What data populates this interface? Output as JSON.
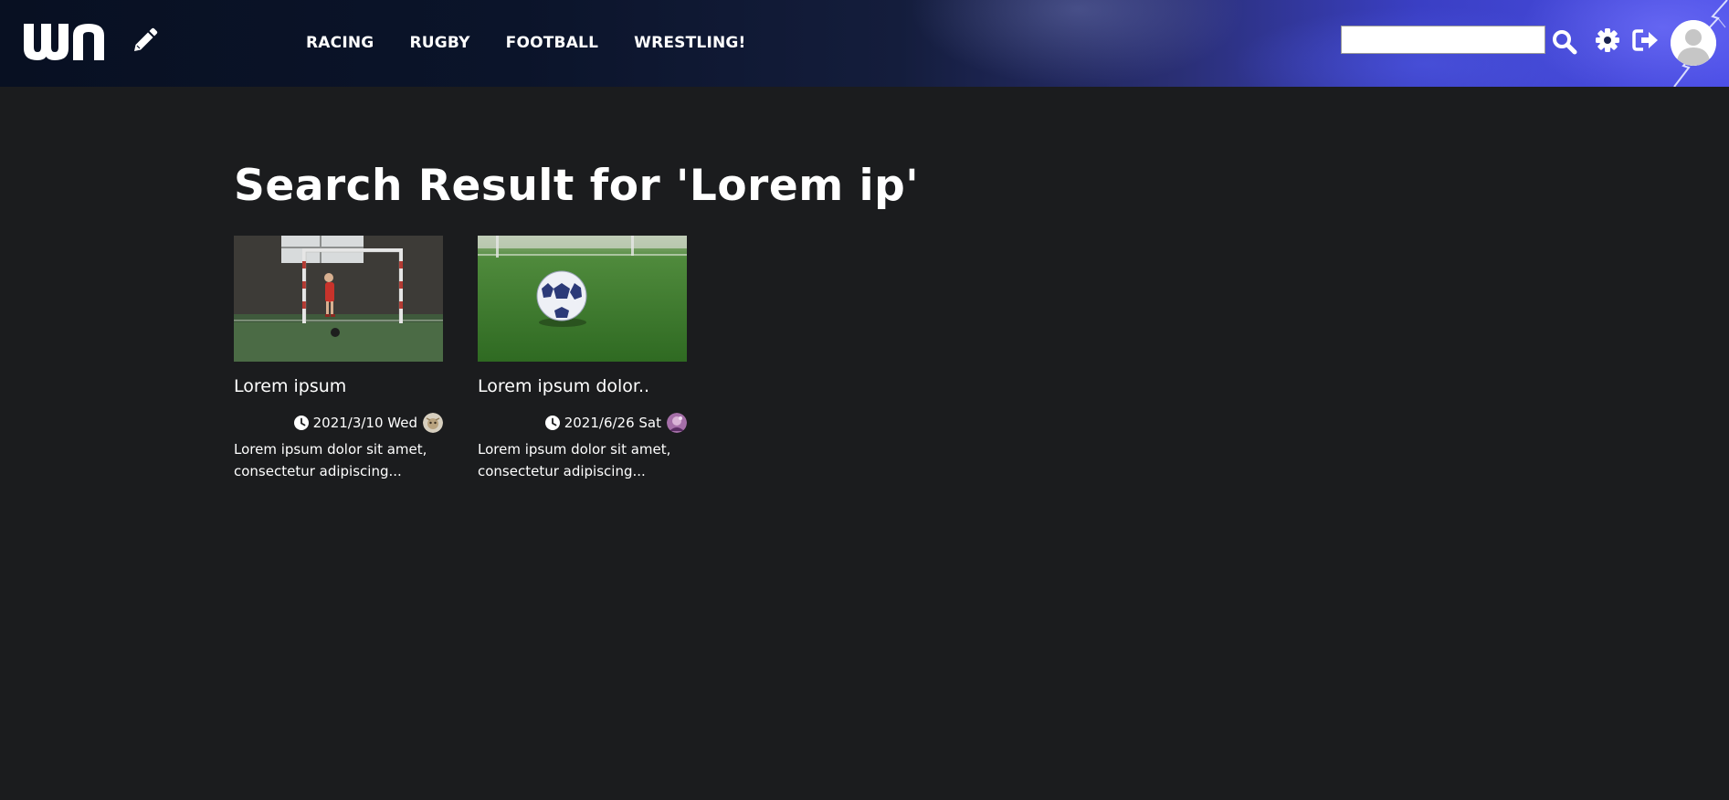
{
  "header": {
    "logo_text": "wn",
    "nav": [
      "RACING",
      "RUGBY",
      "FOOTBALL",
      "WRESTLING!"
    ],
    "search": {
      "value": "",
      "placeholder": ""
    },
    "icons": [
      "pencil-icon",
      "search-icon",
      "gear-icon",
      "logout-icon",
      "user-avatar-icon"
    ]
  },
  "main": {
    "title": "Search Result for 'Lorem ip'",
    "results": [
      {
        "title": "Lorem ipsum",
        "date": "2021/3/10 Wed",
        "excerpt": "Lorem ipsum dolor sit amet, consectetur adipiscing..."
      },
      {
        "title": "Lorem ipsum dolor..",
        "date": "2021/6/26 Sat",
        "excerpt": "Lorem ipsum dolor sit amet, consectetur adipiscing..."
      }
    ]
  },
  "colors": {
    "background": "#1b1c1e",
    "header_dark": "#081022",
    "header_accent": "#4b4ee6",
    "text": "#ffffff"
  }
}
